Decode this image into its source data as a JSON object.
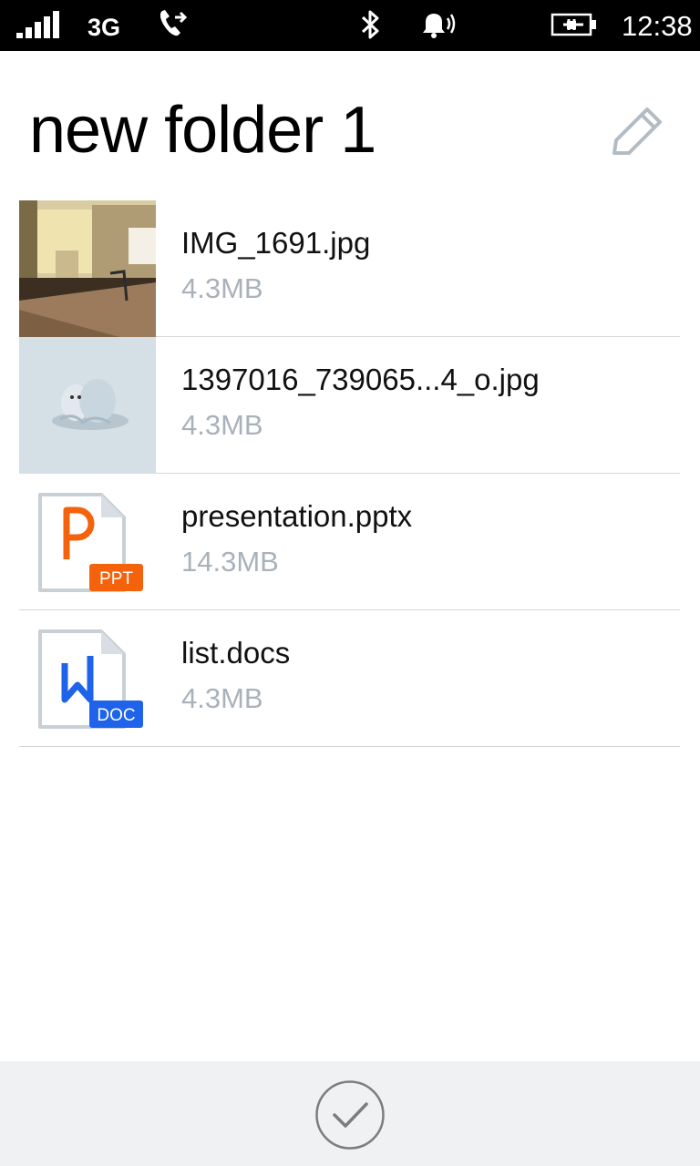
{
  "status_bar": {
    "network": "3G",
    "time": "12:38",
    "icons": [
      "signal-icon",
      "call-forwarding-icon",
      "bluetooth-icon",
      "ringer-icon",
      "battery-charging-icon"
    ]
  },
  "header": {
    "title": "new folder 1",
    "edit_icon": "pencil-icon"
  },
  "files": [
    {
      "name": "IMG_1691.jpg",
      "size": "4.3MB",
      "kind": "photo"
    },
    {
      "name": "1397016_739065...4_o.jpg",
      "size": "4.3MB",
      "kind": "photo"
    },
    {
      "name": "presentation.pptx",
      "size": "14.3MB",
      "kind": "ppt",
      "badge": "PPT",
      "badge_color": "#f5620c"
    },
    {
      "name": "list.docs",
      "size": "4.3MB",
      "kind": "doc",
      "badge": "DOC",
      "badge_color": "#1e63e9"
    }
  ],
  "app_bar": {
    "confirm_icon": "checkmark-icon"
  },
  "colors": {
    "secondary_text": "#a9b2ba",
    "app_bar_bg": "#f0f1f2"
  }
}
